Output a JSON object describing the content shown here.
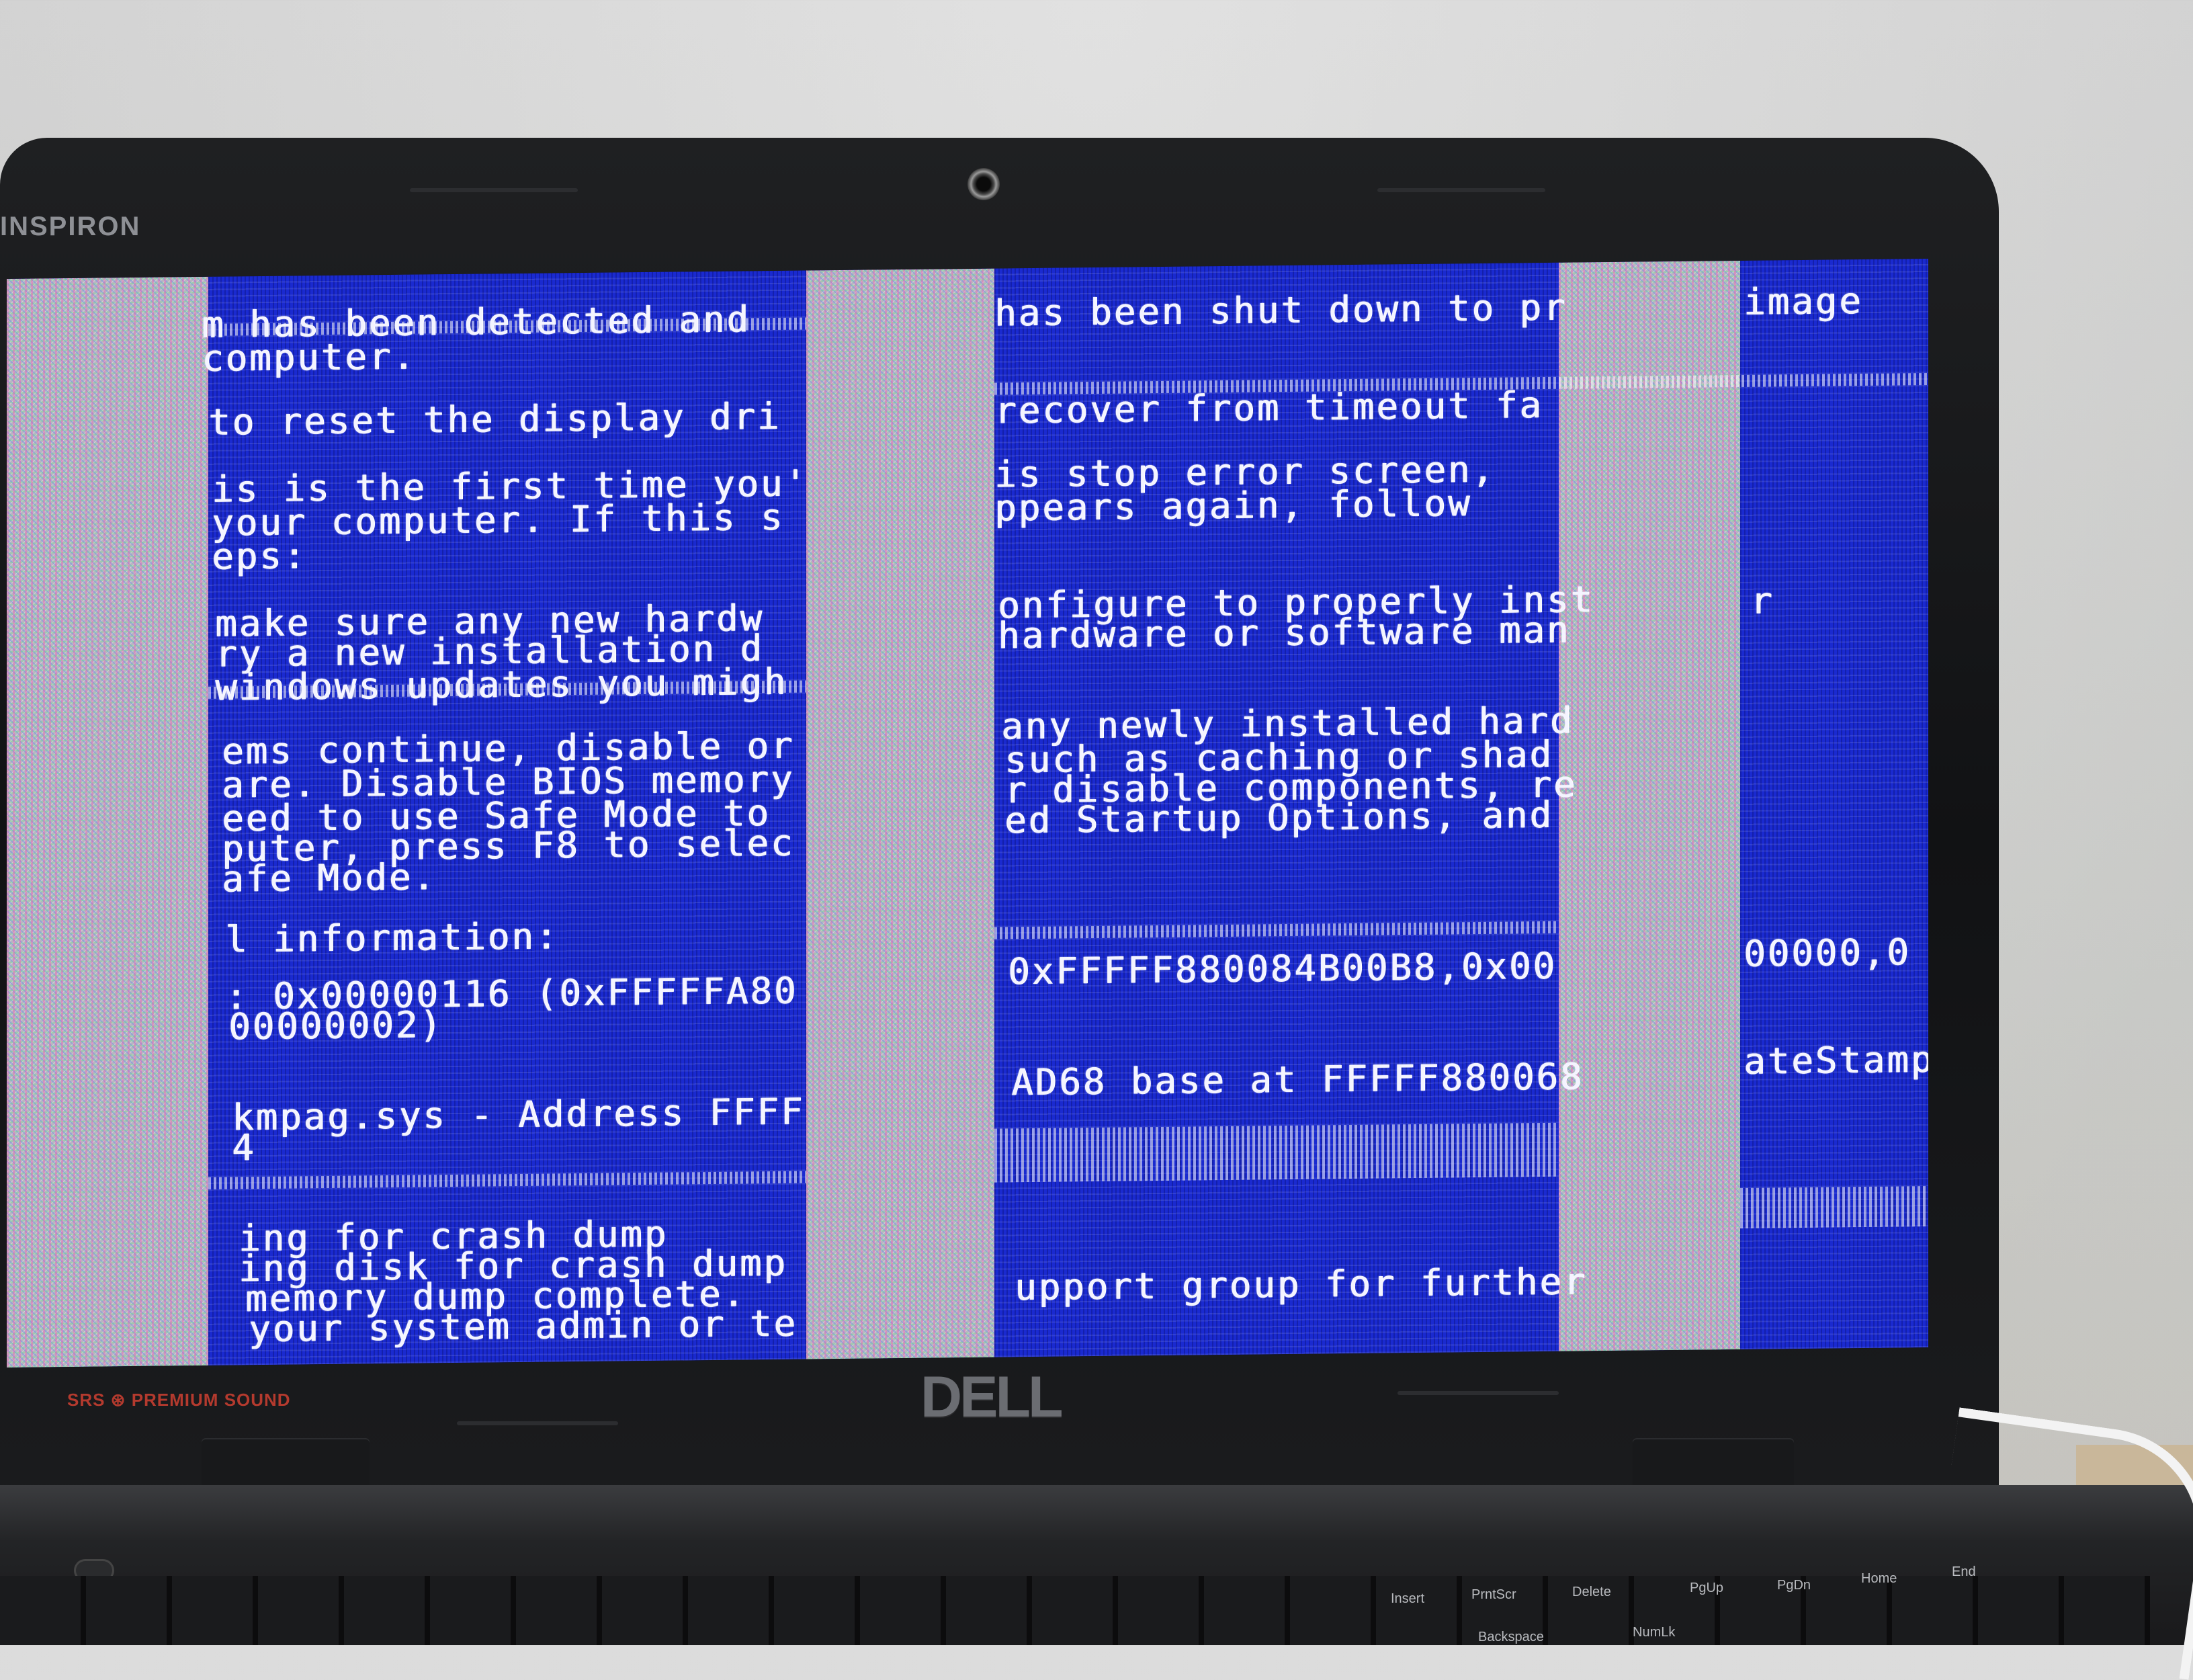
{
  "laptop": {
    "brand_model": "INSPIRON",
    "logo": "DELL",
    "audio_badge": "SRS ⊛ PREMIUM SOUND"
  },
  "screen": {
    "state": "corrupted blue screen of death",
    "bsod_lines": [
      "m has been detected and",
      "has been shut down to pr",
      "image",
      "computer.",
      "to reset the display dri",
      "recover from timeout fa",
      "is is the first time you'",
      "is stop error screen,",
      "your computer. If this s",
      "ppears again, follow",
      "eps:",
      "make sure any new hardw",
      "onfigure to properly inst",
      "ry a new installation d",
      "hardware or software man",
      "r",
      "windows updates you migh",
      "ems continue, disable or",
      "any newly installed hard",
      "are. Disable BIOS memory",
      "such as caching or shad",
      "eed to use Safe Mode to",
      "r disable components, re",
      "puter, press F8 to selec",
      "ed Startup Options, and",
      "afe Mode.",
      "l information:",
      ": 0x00000116 (0xFFFFFA80",
      "0xFFFFF880084B00B8,0x00",
      "00000,0",
      "00000002)",
      "kmpag.sys - Address FFFF",
      "AD68 base at FFFFF880068",
      "ateStamp",
      "4",
      "ing for crash dump",
      "ing disk for crash dump",
      "memory dump complete.",
      "your system admin or te",
      "upport group for further"
    ]
  },
  "keyboard": {
    "keys": [
      "Insert",
      "PrntScr",
      "Delete",
      "PgUp",
      "PgDn",
      "Home",
      "End",
      "Backspace",
      "NumLk"
    ]
  }
}
